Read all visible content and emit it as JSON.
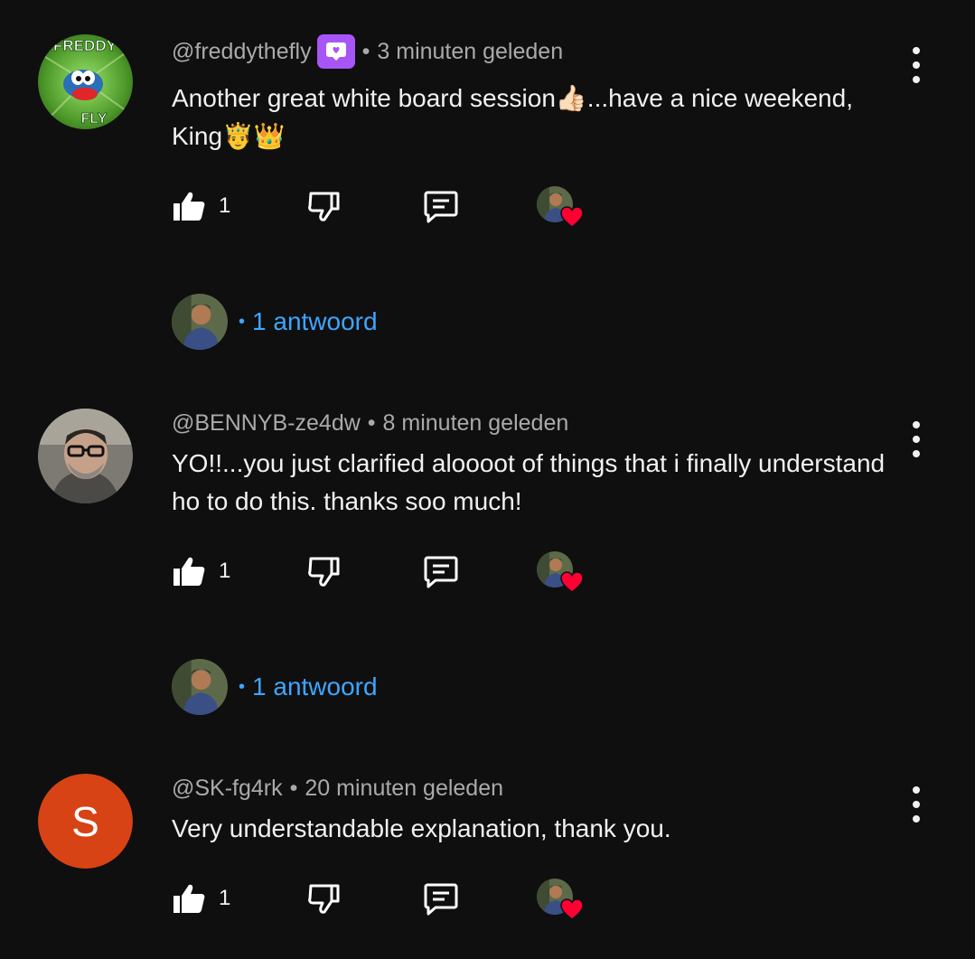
{
  "comments": [
    {
      "handle": "@freddythefly",
      "has_badge": true,
      "time": "3 minuten geleden",
      "text": "Another great white board session👍🏻...have a nice weekend, King🤴👑",
      "likes": "1",
      "avatar_text_top": "FREDDY",
      "avatar_text_bottom": "FLY",
      "replies_label": "1 antwoord"
    },
    {
      "handle": "@BENNYB-ze4dw",
      "time": "8 minuten geleden",
      "text": "YO!!...you just clarified aloooot of things that i finally understand ho to do this. thanks soo much!",
      "likes": "1",
      "replies_label": "1 antwoord"
    },
    {
      "handle": "@SK-fg4rk",
      "time": "20 minuten geleden",
      "text": "Very understandable explanation, thank you.",
      "likes": "1",
      "avatar_letter": "S"
    }
  ],
  "separator": "•",
  "icons": {
    "like": "thumbs-up-icon",
    "dislike": "thumbs-down-icon",
    "reply": "comment-icon",
    "more": "more-vertical-icon",
    "heart": "heart-icon"
  },
  "colors": {
    "background": "#0f0f0f",
    "meta_text": "#aaaaaa",
    "reply_link": "#3ea6ff",
    "badge": "#a855f7",
    "heart": "#ff0033",
    "letter_avatar": "#d84315"
  }
}
